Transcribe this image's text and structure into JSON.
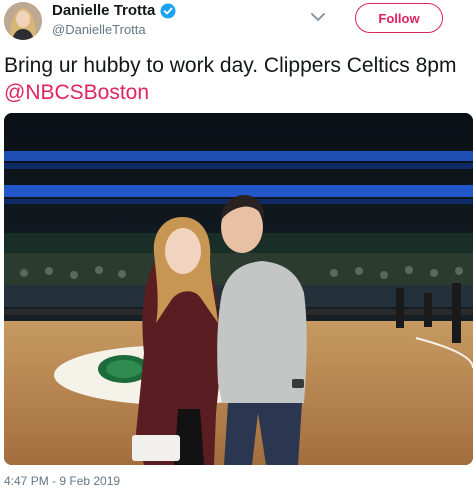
{
  "tweet": {
    "display_name": "Danielle Trotta",
    "handle": "@DanielleTrotta",
    "follow_label": "Follow",
    "text_main": "Bring ur hubby to work day. Clippers Celtics 8pm ",
    "mention": "@NBCSBoston",
    "timestamp": "4:47 PM - 9 Feb 2019"
  },
  "colors": {
    "accent": "#e0245e",
    "verified": "#1da1f2",
    "text": "#14171a",
    "muted": "#657786"
  },
  "icons": {
    "verified": "verified-badge-icon",
    "menu": "chevron-down-icon"
  }
}
